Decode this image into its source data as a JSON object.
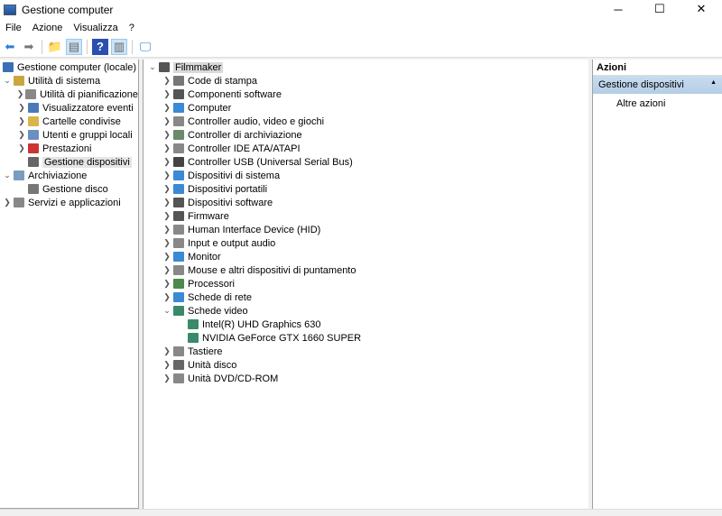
{
  "window": {
    "title": "Gestione computer",
    "minimize": "─",
    "maximize": "☐",
    "close": "✕"
  },
  "menu": [
    "File",
    "Azione",
    "Visualizza",
    "?"
  ],
  "toolbar": [
    {
      "name": "back-icon",
      "glyph": "⬅",
      "color": "#2a7fd4"
    },
    {
      "name": "forward-icon",
      "glyph": "➡",
      "color": "#777"
    },
    {
      "name": "up-folder-icon",
      "glyph": "📁",
      "color": "#d9a93a"
    },
    {
      "name": "show-hide-tree-icon",
      "glyph": "▤",
      "color": "#666"
    },
    {
      "name": "help-icon",
      "glyph": "?",
      "color": "#2a4fb0"
    },
    {
      "name": "show-action-pane-icon",
      "glyph": "▥",
      "color": "#666"
    },
    {
      "name": "monitor-icon",
      "glyph": "🖵",
      "color": "#2a7fd4"
    }
  ],
  "left_tree": [
    {
      "label": "Gestione computer (locale)",
      "level": 0,
      "exp": "",
      "color": "#3b6fb5"
    },
    {
      "label": "Utilità di sistema",
      "level": 0,
      "exp": "v",
      "color": "#c9a640"
    },
    {
      "label": "Utilità di pianificazione",
      "level": 1,
      "exp": ">",
      "color": "#888"
    },
    {
      "label": "Visualizzatore eventi",
      "level": 1,
      "exp": ">",
      "color": "#4a7ab8"
    },
    {
      "label": "Cartelle condivise",
      "level": 1,
      "exp": ">",
      "color": "#d9b44a"
    },
    {
      "label": "Utenti e gruppi locali",
      "level": 1,
      "exp": ">",
      "color": "#6a8fc0"
    },
    {
      "label": "Prestazioni",
      "level": 1,
      "exp": ">",
      "color": "#cc3333"
    },
    {
      "label": "Gestione dispositivi",
      "level": 1,
      "exp": "",
      "color": "#666",
      "selected": true
    },
    {
      "label": "Archiviazione",
      "level": 0,
      "exp": "v",
      "color": "#7a9cc0"
    },
    {
      "label": "Gestione disco",
      "level": 1,
      "exp": "",
      "color": "#777"
    },
    {
      "label": "Servizi e applicazioni",
      "level": 0,
      "exp": ">",
      "color": "#888"
    }
  ],
  "device_tree": {
    "root": "Filmmaker",
    "items": [
      {
        "label": "Code di stampa",
        "exp": ">",
        "color": "#777"
      },
      {
        "label": "Componenti software",
        "exp": ">",
        "color": "#555"
      },
      {
        "label": "Computer",
        "exp": ">",
        "color": "#3a8ad4"
      },
      {
        "label": "Controller audio, video e giochi",
        "exp": ">",
        "color": "#888"
      },
      {
        "label": "Controller di archiviazione",
        "exp": ">",
        "color": "#6a8a6a"
      },
      {
        "label": "Controller IDE ATA/ATAPI",
        "exp": ">",
        "color": "#888"
      },
      {
        "label": "Controller USB (Universal Serial Bus)",
        "exp": ">",
        "color": "#444"
      },
      {
        "label": "Dispositivi di sistema",
        "exp": ">",
        "color": "#3a8ad4"
      },
      {
        "label": "Dispositivi portatili",
        "exp": ">",
        "color": "#3a8ad4"
      },
      {
        "label": "Dispositivi software",
        "exp": ">",
        "color": "#555"
      },
      {
        "label": "Firmware",
        "exp": ">",
        "color": "#555"
      },
      {
        "label": "Human Interface Device (HID)",
        "exp": ">",
        "color": "#888"
      },
      {
        "label": "Input e output audio",
        "exp": ">",
        "color": "#888"
      },
      {
        "label": "Monitor",
        "exp": ">",
        "color": "#3a8ad4"
      },
      {
        "label": "Mouse e altri dispositivi di puntamento",
        "exp": ">",
        "color": "#888"
      },
      {
        "label": "Processori",
        "exp": ">",
        "color": "#4a8a4a"
      },
      {
        "label": "Schede di rete",
        "exp": ">",
        "color": "#3a8ad4"
      },
      {
        "label": "Schede video",
        "exp": "v",
        "color": "#3a8a6a"
      },
      {
        "label": "Intel(R) UHD Graphics 630",
        "exp": "",
        "color": "#3a8a6a",
        "child": true
      },
      {
        "label": "NVIDIA GeForce GTX 1660 SUPER",
        "exp": "",
        "color": "#3a8a6a",
        "child": true
      },
      {
        "label": "Tastiere",
        "exp": ">",
        "color": "#888"
      },
      {
        "label": "Unità disco",
        "exp": ">",
        "color": "#666"
      },
      {
        "label": "Unità DVD/CD-ROM",
        "exp": ">",
        "color": "#888"
      }
    ]
  },
  "actions": {
    "header": "Azioni",
    "section": "Gestione dispositivi",
    "section_arrow": "▲",
    "item": "Altre azioni",
    "item_arrow": "▶"
  }
}
